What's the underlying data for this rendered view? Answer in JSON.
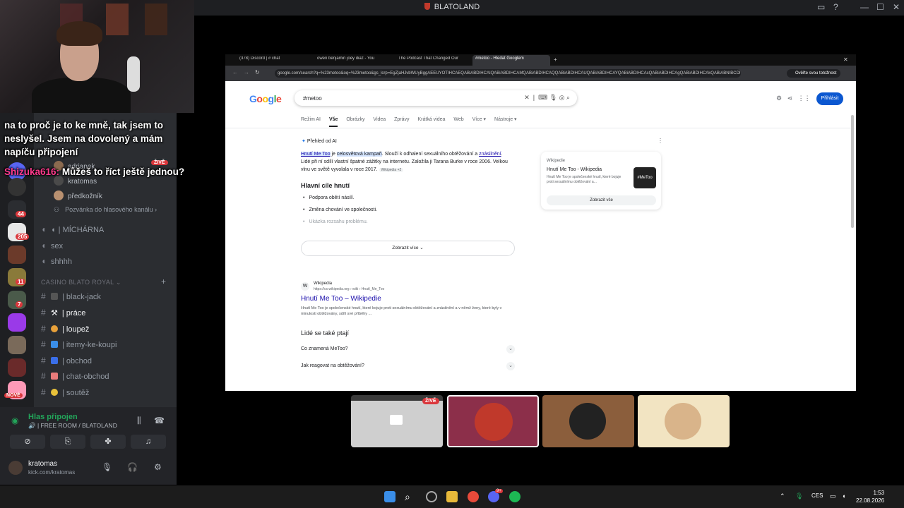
{
  "window": {
    "title": "BLATOLAND"
  },
  "overlay": {
    "line1": "na to proč je to ke mně, tak jsem to",
    "line2": "neslyšel. Jsem na dovolený a mám",
    "line3": "napíču připojení",
    "chat_nick": "Shizuka616:",
    "chat_msg": "Můžeš to říct ještě jednou?"
  },
  "rail_badges": [
    "44",
    "205",
    "11",
    "7",
    "NOVÉ"
  ],
  "channels": {
    "voice_users": [
      "adrianek",
      "kratomas",
      "předkožník"
    ],
    "invite": "Pozvánka do hlasového kanálu",
    "items_top": [
      {
        "icon": "🔊",
        "label": "MÍCHÁRNA"
      },
      {
        "icon": "🔊",
        "label": "sex"
      },
      {
        "icon": "🔊",
        "label": "shhhh"
      }
    ],
    "category": "CASINO BLATO ROYAL",
    "text_channels": [
      {
        "label": "black-jack",
        "color": "#555"
      },
      {
        "label": "práce",
        "color": "#7a7a7a"
      },
      {
        "label": "loupež",
        "color": "#e8a13a"
      },
      {
        "label": "itemy-ke-koupi",
        "color": "#3a8ee8"
      },
      {
        "label": "obchod",
        "color": "#3a6ee8"
      },
      {
        "label": "chat-obchod",
        "color": "#e87b7b"
      },
      {
        "label": "soutěž",
        "color": "#e8c13a"
      }
    ]
  },
  "voice_panel": {
    "status": "Hlas připojen",
    "room": "FREE ROOM / BLATOLAND",
    "user": "kratomas",
    "sub": "kick.com/kratomas"
  },
  "browser": {
    "tabs": [
      "(378) Discord | # chat",
      "owen benjamin joey diaz - You",
      "The Podcast That Changed Our",
      "#metoo - Hledat Googlem"
    ],
    "url": "google.com/search?q=%23metoo&oq=%23metoo&gs_lcrp=EgZjaHJvbWUyBggAEEUYOTIHCAEQABiABDIHCAIQABiABDIHCAMQABiABDIHCAQQABiABDIHCAUQABiABDIHCAYQABiABDIHCAcQABiABDIHCAgQABiABDIHCAkQABiABNIBCDI",
    "verify": "Ověřte svou totožnost",
    "search_query": "#metoo",
    "signin": "Přihlásit",
    "gtabs": [
      "Režim AI",
      "Vše",
      "Obrázky",
      "Videa",
      "Zprávy",
      "Krátká videa",
      "Web",
      "Více ▾",
      "Nástroje ▾"
    ],
    "ai_overview_title": "Přehled od AI",
    "ai_text_a": "Hnutí Me Too",
    "ai_text_b": " je ",
    "ai_text_c": "celosvětová kampaň",
    "ai_text_d": ". Slouží k odhalení sexuálního obtěžování a ",
    "ai_text_e": "znásilnění",
    "ai_text_f": ". Lidé při ní sdílí vlastní špatné zážitky na internetu. Založila ji Tarana Burke v roce 2006. Velkou vlnu ve světě vyvolala v roce 2017.",
    "ai_text_src": "Wikipedia +2",
    "goals_heading": "Hlavní cíle hnutí",
    "goals": [
      "Podpora obětí násilí.",
      "Změna chování ve společnosti.",
      "Ukázka rozsahu problému."
    ],
    "show_more": "Zobrazit více",
    "wiki_card": {
      "source": "Wikipedie",
      "title": "Hnutí Me Too - Wikipedia",
      "desc": "Hnutí Me Too je společenské hnutí, které bojuje proti sexuálnímu obtěžování a...",
      "img_text": "#MeToo",
      "button": "Zobrazit vše"
    },
    "result": {
      "site": "Wikipedia",
      "url": "https://cs.wikipedia.org › wiki › Hnutí_Me_Too",
      "title": "Hnutí Me Too – Wikipedie",
      "snippet": "Hnutí Me Too je společenské hnutí, které bojuje proti sexuálnímu obtěžování a znásilnění a v němž ženy, které byly v minulosti obtěžovány, sdílí své příběhy ..."
    },
    "paa_heading": "Lidé se také ptají",
    "paa": [
      "Co znamená MeToo?",
      "Jak reagovat na obtěžování?"
    ]
  },
  "participants": {
    "live": "ŽIVĚ"
  },
  "taskbar": {
    "lang": "CES",
    "time": "1:53",
    "date": "22.08.2026",
    "discord_badge": "9+"
  }
}
